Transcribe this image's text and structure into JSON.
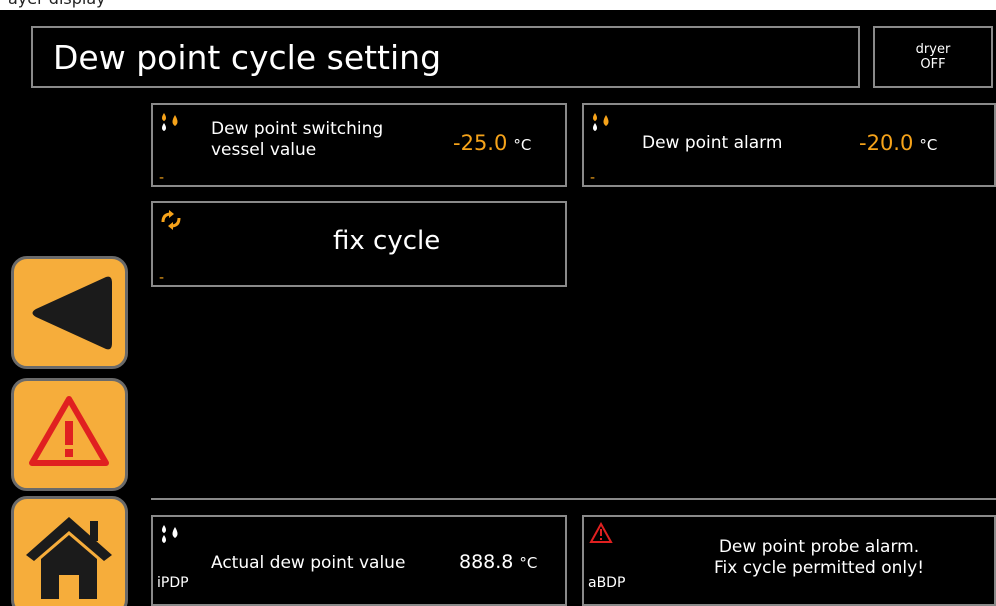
{
  "top_strip_text": "ayer display",
  "header": {
    "title": "Dew point cycle setting"
  },
  "status": {
    "line1": "dryer",
    "line2": "OFF"
  },
  "params": [
    {
      "label_line1": "Dew point switching",
      "label_line2": "vessel value",
      "value": "-25.0",
      "unit": "°C",
      "dash": "-"
    },
    {
      "label": "Dew point alarm",
      "value": "-20.0",
      "unit": "°C",
      "dash": "-"
    },
    {
      "label": "fix cycle",
      "dash": "-"
    }
  ],
  "bottom": {
    "actual": {
      "tag": "iPDP",
      "label": "Actual dew point value",
      "value": "888.8",
      "unit": "°C"
    },
    "alarm": {
      "tag": "aBDP",
      "line1": "Dew point probe alarm.",
      "line2": "Fix cycle permitted only!"
    }
  },
  "nav": [
    "back",
    "alarm",
    "home"
  ],
  "colors": {
    "accent": "#f6a31a",
    "button": "#f6ad3b",
    "border": "#8a8a8a",
    "alarm": "#e02020"
  },
  "icons": [
    "drops-icon",
    "cycle-arrows-icon",
    "warning-icon",
    "back-arrow-icon",
    "home-icon"
  ]
}
